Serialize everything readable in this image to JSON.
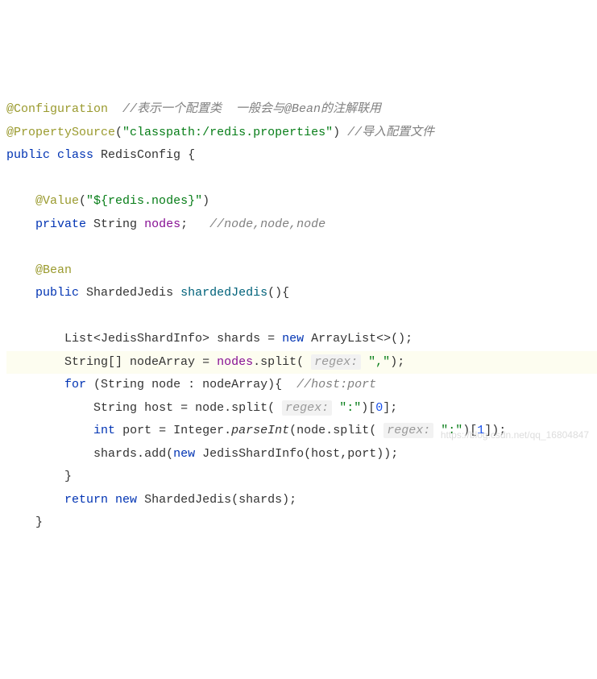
{
  "code": {
    "configuration": "@Configuration",
    "comment1": "//表示一个配置类  一般会与@Bean的注解联用",
    "propertySource": "@PropertySource",
    "propertyPath": "\"classpath:/redis.properties\"",
    "comment2": "//导入配置文件",
    "publicClass": "public class",
    "className": "RedisConfig",
    "value": "@Value",
    "valueParam": "\"${redis.nodes}\"",
    "privateStr": "private",
    "stringType": "String",
    "nodesField": "nodes",
    "nodesComment": "//node,node,node",
    "bean": "@Bean",
    "publicKw": "public",
    "shardedJedisType": "ShardedJedis",
    "shardedJedisMethod": "shardedJedis",
    "listJedis": "List<JedisShardInfo>",
    "shardsVar": "shards",
    "newKw": "new",
    "arrayList": "ArrayList<>()",
    "stringArr": "String[]",
    "nodeArrayVar": "nodeArray",
    "splitMethod": "split",
    "regexHint": "regex:",
    "commaStr": "\",\"",
    "forKw": "for",
    "nodeVar": "node",
    "hostPortComment": "//host:port",
    "hostVar": "host",
    "colonStr": "\":\"",
    "idx0": "0",
    "intKw": "int",
    "portVar": "port",
    "integerType": "Integer",
    "parseInt": "parseInt",
    "idx1": "1",
    "addMethod": "add",
    "jedisShardInfo": "JedisShardInfo",
    "returnKw": "return",
    "shardedJedisNew": "ShardedJedis"
  },
  "watermark": "https://blog.csdn.net/qq_16804847"
}
